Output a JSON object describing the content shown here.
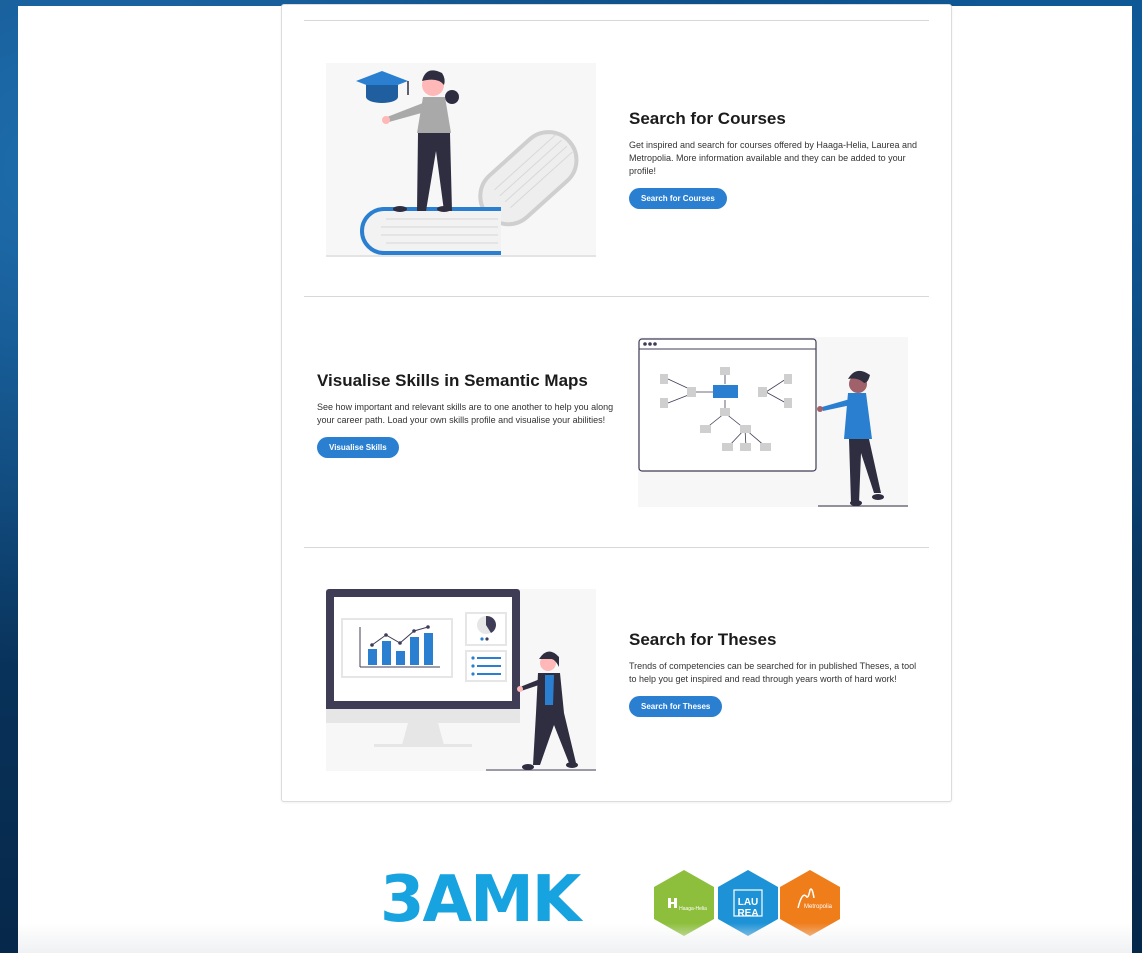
{
  "sections": [
    {
      "title": "Search for Courses",
      "description": "Get inspired and search for courses offered by Haaga-Helia, Laurea and Metropolia. More information available and they can be added to your profile!",
      "button": "Search for Courses"
    },
    {
      "title": "Visualise Skills in Semantic Maps",
      "description": "See how important and relevant skills are to one another to help you along your career path. Load your own skills profile and visualise your abilities!",
      "button": "Visualise Skills"
    },
    {
      "title": "Search for Theses",
      "description": "Trends of competencies can be searched for in published Theses, a tool to help you get inspired and read through years worth of hard work!",
      "button": "Search for Theses"
    }
  ],
  "footer": {
    "logo_text": "3AMK",
    "partners": [
      {
        "name": "Haaga-Helia",
        "color": "#8dbf3c"
      },
      {
        "name": "LAU REA",
        "line1": "LAU",
        "line2": "REA",
        "color": "#1d92d6"
      },
      {
        "name": "Metropolia",
        "color": "#ef7d1a"
      }
    ]
  },
  "colors": {
    "accent": "#2a7fd0",
    "logo": "#17a3e0",
    "dark_ink": "#2f2e41"
  }
}
